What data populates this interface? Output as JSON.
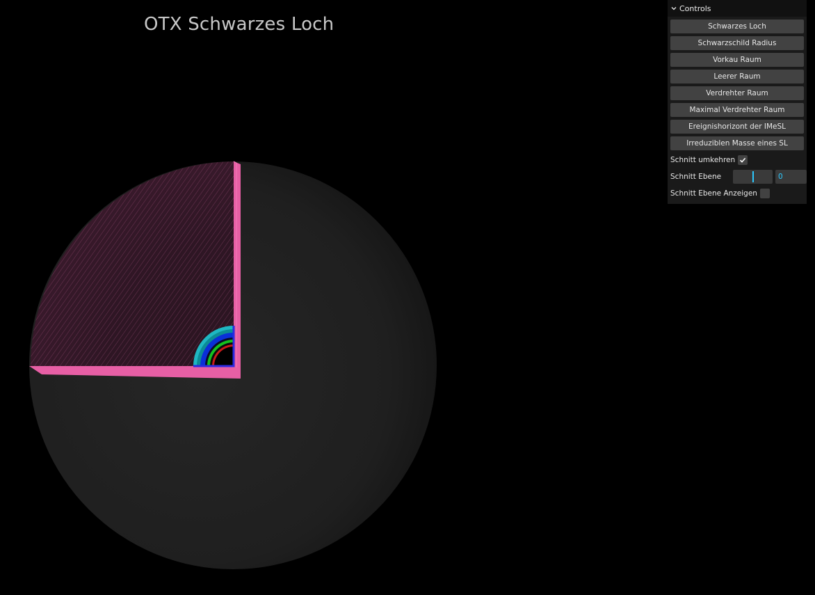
{
  "title": "OTX Schwarzes Loch",
  "colors": {
    "background": "#000000",
    "sphere": "#222222",
    "cut_face": "#e75fa5",
    "cut_shade": "#2a1420",
    "accent": "#2cc9ff"
  },
  "controls": {
    "header": "Controls",
    "buttons": [
      "Schwarzes Loch",
      "Schwarzschild Radius",
      "Vorkau Raum",
      "Leerer Raum",
      "Verdrehter Raum",
      "Maximal Verdrehter Raum",
      "Ereignishorizont der IMeSL",
      "Irreduziblen Masse eines SL"
    ],
    "invert_cut_label": "Schnitt umkehren",
    "invert_cut_checked": true,
    "cut_plane_label": "Schnitt Ebene",
    "cut_plane_value": "0",
    "show_cut_plane_label": "Schnitt Ebene Anzeigen",
    "show_cut_plane_checked": false
  }
}
